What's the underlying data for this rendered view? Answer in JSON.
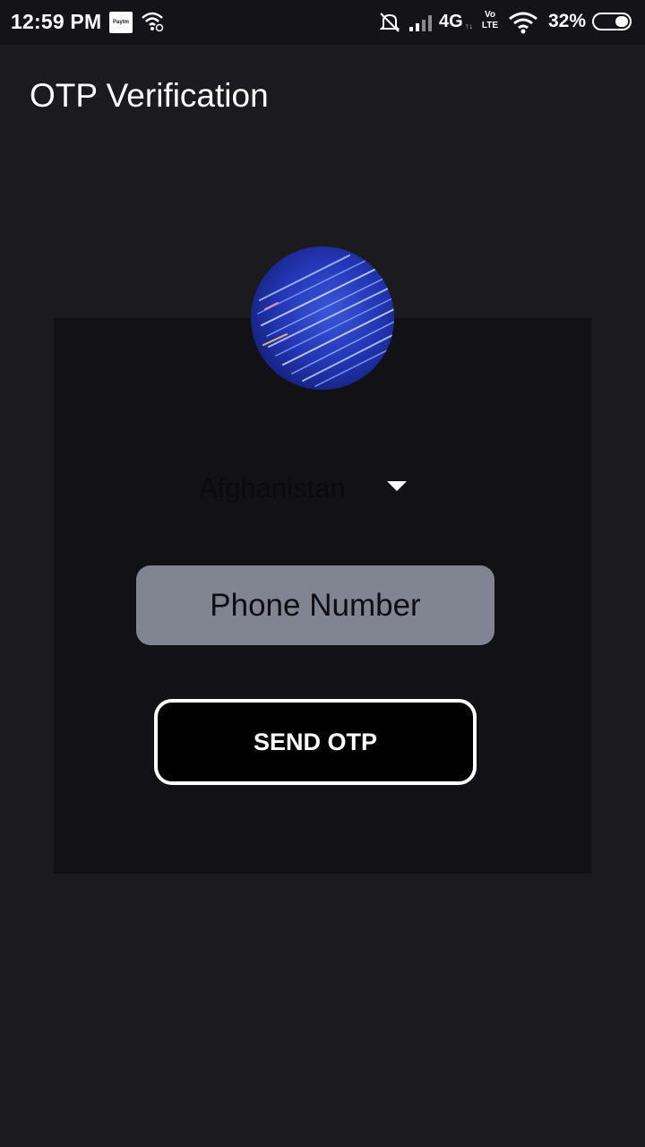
{
  "status_bar": {
    "time": "12:59 PM",
    "paytm_icon_text": "Paytm",
    "network_label": "4G",
    "network_arrows": "↑↓",
    "volte_label": "Vo LTE",
    "battery_percent": "32%",
    "battery_level": 0.32,
    "icons": [
      "paytm-icon",
      "wifi-icon",
      "mute-icon",
      "signal-icon",
      "volte-icon",
      "wifi-icon",
      "battery-icon"
    ]
  },
  "header": {
    "title": "OTP Verification"
  },
  "form": {
    "country": "Afghanistan",
    "phone_placeholder": "Phone Number",
    "phone_value": "",
    "send_label": "SEND OTP"
  },
  "colors": {
    "background": "#1b1a1f",
    "card": "#111116",
    "input": "#818591",
    "button": "#000000",
    "button_border": "#ffffff"
  }
}
